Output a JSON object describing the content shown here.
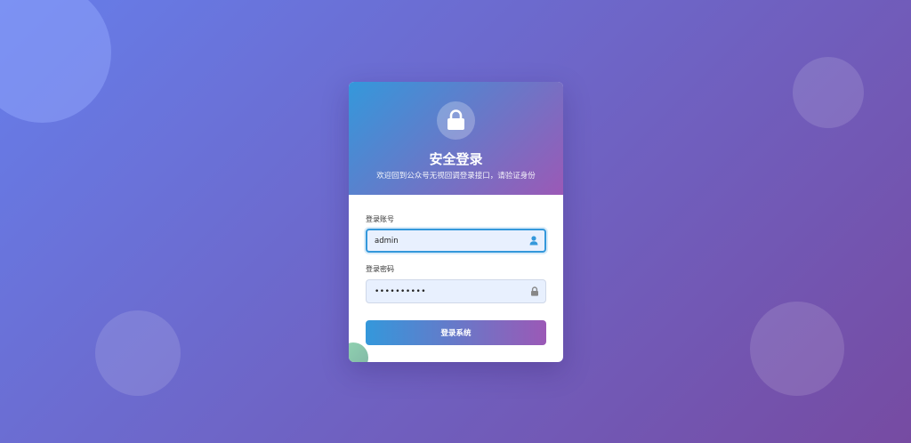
{
  "header": {
    "title": "安全登录",
    "subtitle": "欢迎回到公众号无视回调登录接口，请验证身份"
  },
  "form": {
    "username_label": "登录账号",
    "username_value": "admin",
    "password_label": "登录密码",
    "password_value": "••••••••••"
  },
  "login_button": {
    "label": "登录系统"
  },
  "icons": {
    "header": "lock-icon",
    "username": "user-icon",
    "password": "lock-icon"
  },
  "colors": {
    "background_start": "#667eea",
    "background_end": "#764ba2",
    "accent_blue": "#3498db",
    "accent_purple": "#9b59b6"
  }
}
